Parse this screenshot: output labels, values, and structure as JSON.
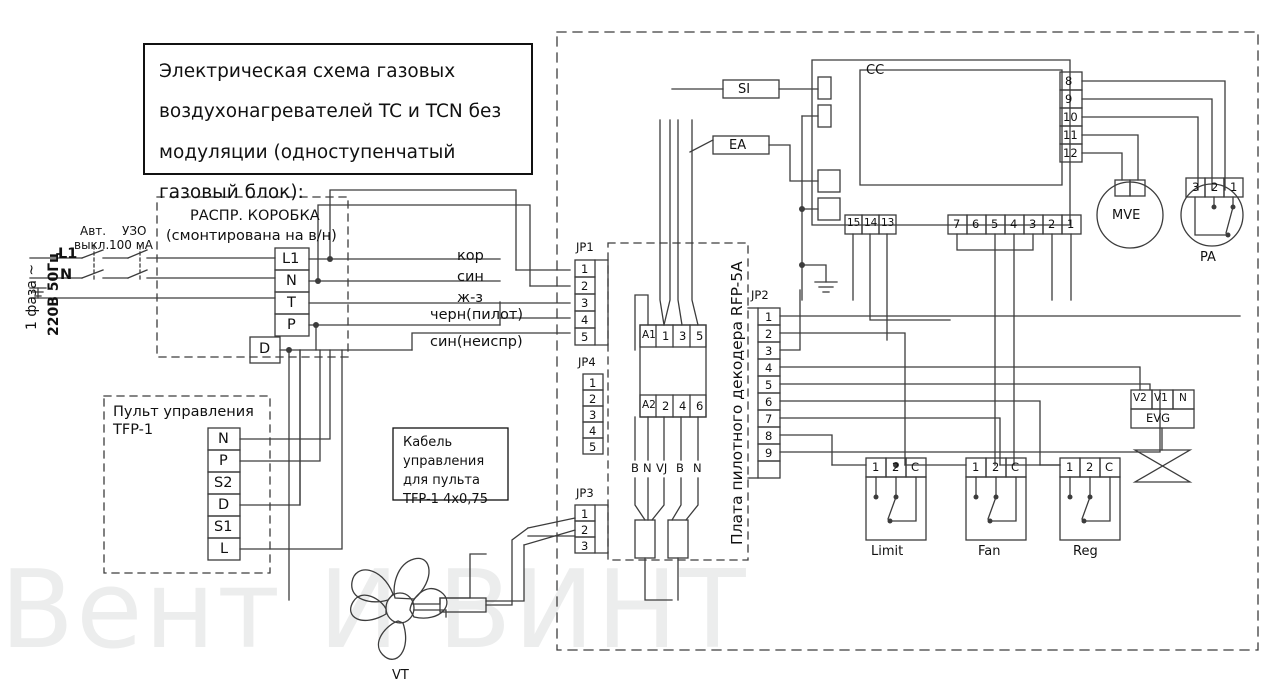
{
  "title_box": {
    "lines": [
      "Электрическая схема газовых",
      "воздухонагревателей TC и TCN без",
      "модуляции (одноступенчатый",
      "газовый блок):"
    ]
  },
  "watermark": {
    "text": "Вент И ВИНТ"
  },
  "power_source": {
    "line1": "1 фаза ~",
    "line2": "220В 50Гц",
    "breaker_label1": "Авт.",
    "breaker_label2": "выкл.",
    "rcd_label": "УЗО",
    "rcd_value": "100 мА",
    "terminals": [
      "L1",
      "N"
    ]
  },
  "junction_box": {
    "title_line1": "РАСПР. КОРОБКА",
    "title_line2": "(смонтирована на в/н)",
    "terminals": [
      "L1",
      "N",
      "T",
      "P"
    ],
    "extra_terminal": "D"
  },
  "control_panel": {
    "title_line1": "Пульт управления",
    "title_line2": "TFP-1",
    "terminals": [
      "N",
      "P",
      "S2",
      "D",
      "S1",
      "L"
    ]
  },
  "cable_note": {
    "lines": [
      "Кабель",
      "управления",
      "для пульта",
      "TFP-1 4x0,75"
    ]
  },
  "wire_labels": [
    "кор",
    "син",
    "ж-з",
    "черн(пилот)",
    "син(неиспр)"
  ],
  "decoder_board": {
    "label": "Плата пилотного декодера RFP-5A",
    "connectors": [
      {
        "name": "JP1",
        "pins": [
          "1",
          "2",
          "3",
          "4",
          "5"
        ]
      },
      {
        "name": "JP4",
        "pins": [
          "1",
          "2",
          "3",
          "4",
          "5"
        ]
      },
      {
        "name": "JP3",
        "pins": [
          "1",
          "2",
          "3"
        ]
      },
      {
        "name": "JP2",
        "pins": [
          "1",
          "2",
          "3",
          "4",
          "5",
          "6",
          "7",
          "8",
          "9",
          ""
        ]
      }
    ],
    "relay": {
      "top_pins": [
        "A1",
        "1",
        "3",
        "5"
      ],
      "bottom_pins": [
        "A2",
        "2",
        "4",
        "6"
      ],
      "wire_labels": [
        "B",
        "N",
        "VJ",
        "B",
        "N"
      ]
    }
  },
  "controller": {
    "name": "CC",
    "bottom_left_terminals": [
      "15",
      "14",
      "13"
    ],
    "bottom_right_terminals": [
      "7",
      "6",
      "5",
      "4",
      "3",
      "2",
      "1"
    ],
    "right_terminals": [
      "8",
      "9",
      "10",
      "11",
      "12"
    ]
  },
  "components": {
    "si": "SI",
    "ea": "EA",
    "mve": "MVE",
    "pa": "PA",
    "pa_terminals": [
      "3",
      "2",
      "1"
    ],
    "evg": "EVG",
    "evg_terminals": [
      "V2",
      "V1",
      "N"
    ],
    "fan": "VT"
  },
  "thermostats": [
    {
      "name": "Limit",
      "terminals": [
        "1",
        "2",
        "C"
      ]
    },
    {
      "name": "Fan",
      "terminals": [
        "1",
        "2",
        "C"
      ]
    },
    {
      "name": "Reg",
      "terminals": [
        "1",
        "2",
        "C"
      ]
    }
  ],
  "colors": {
    "line": "#3c3c3c",
    "text": "#111111",
    "watermark": "#eceded"
  }
}
